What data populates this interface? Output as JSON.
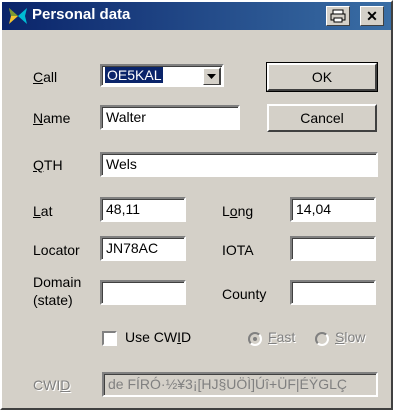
{
  "window": {
    "title": "Personal data",
    "buttons": {
      "print_icon": "printer-icon",
      "close_glyph": "✕"
    }
  },
  "form": {
    "call": {
      "label": "Call",
      "value": "OE5KAL"
    },
    "name": {
      "label": "Name",
      "value": "Walter"
    },
    "qth": {
      "label": "QTH",
      "value": "Wels"
    },
    "lat": {
      "label": "Lat",
      "value": "48,11"
    },
    "long": {
      "label": "Long",
      "value": "14,04"
    },
    "locator": {
      "label": "Locator",
      "value": "JN78AC"
    },
    "iota": {
      "label": "IOTA",
      "value": ""
    },
    "domain": {
      "label_line1": "Domain",
      "label_line2": "(state)",
      "value": ""
    },
    "county": {
      "label": "County",
      "value": ""
    },
    "use_cwid": {
      "label": "Use CWID",
      "checked": false
    },
    "speed": {
      "fast": {
        "label": "Fast",
        "selected": true
      },
      "slow": {
        "label": "Slow",
        "selected": false
      }
    },
    "cwid": {
      "label": "CWID",
      "value": "de FÍRÓ·½¥3¡[HJ§UÖÌ]Úî+ÜF|ÉŸGLÇ"
    }
  },
  "buttons": {
    "ok": "OK",
    "cancel": "Cancel"
  },
  "colors": {
    "titlebar_start": "#0a246a",
    "titlebar_end": "#3a6ea5",
    "face": "#d4d0c8"
  }
}
